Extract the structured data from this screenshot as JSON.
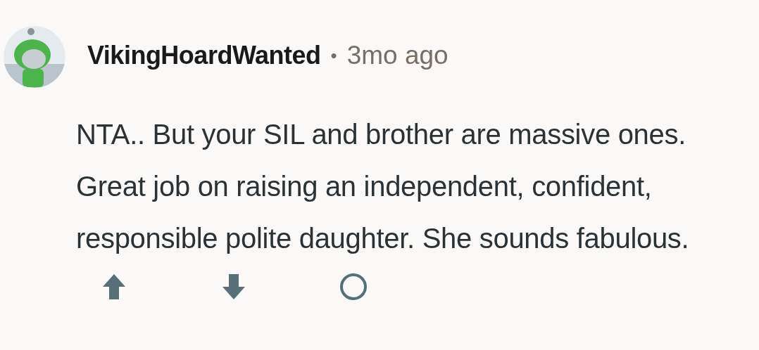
{
  "comment": {
    "author": "VikingHoardWanted",
    "separator": "•",
    "age": "3mo ago",
    "body": "NTA.. But your SIL and brother are massive ones. Great job on raising an independent, confident, responsible polite daughter. She sounds fabulous."
  }
}
